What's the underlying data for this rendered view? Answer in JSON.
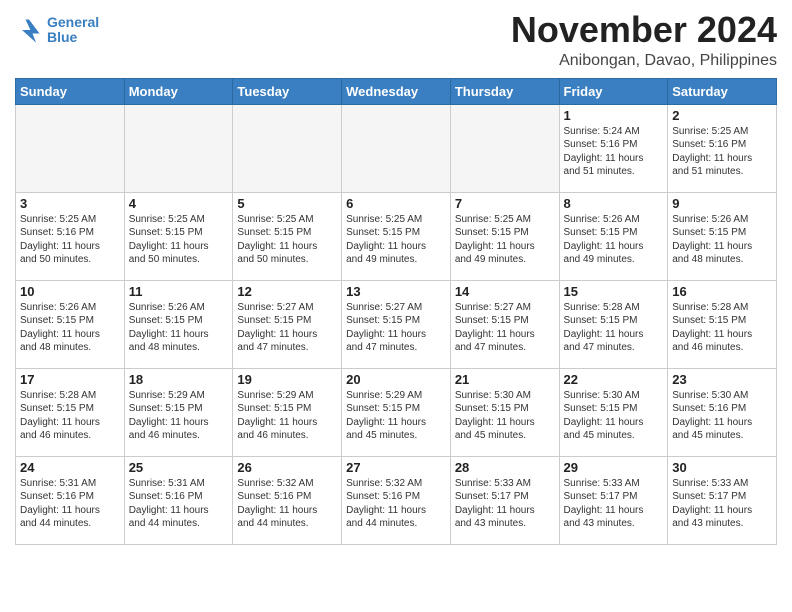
{
  "header": {
    "logo_line1": "General",
    "logo_line2": "Blue",
    "month": "November 2024",
    "location": "Anibongan, Davao, Philippines"
  },
  "days_of_week": [
    "Sunday",
    "Monday",
    "Tuesday",
    "Wednesday",
    "Thursday",
    "Friday",
    "Saturday"
  ],
  "weeks": [
    [
      {
        "day": "",
        "info": ""
      },
      {
        "day": "",
        "info": ""
      },
      {
        "day": "",
        "info": ""
      },
      {
        "day": "",
        "info": ""
      },
      {
        "day": "",
        "info": ""
      },
      {
        "day": "1",
        "info": "Sunrise: 5:24 AM\nSunset: 5:16 PM\nDaylight: 11 hours\nand 51 minutes."
      },
      {
        "day": "2",
        "info": "Sunrise: 5:25 AM\nSunset: 5:16 PM\nDaylight: 11 hours\nand 51 minutes."
      }
    ],
    [
      {
        "day": "3",
        "info": "Sunrise: 5:25 AM\nSunset: 5:16 PM\nDaylight: 11 hours\nand 50 minutes."
      },
      {
        "day": "4",
        "info": "Sunrise: 5:25 AM\nSunset: 5:15 PM\nDaylight: 11 hours\nand 50 minutes."
      },
      {
        "day": "5",
        "info": "Sunrise: 5:25 AM\nSunset: 5:15 PM\nDaylight: 11 hours\nand 50 minutes."
      },
      {
        "day": "6",
        "info": "Sunrise: 5:25 AM\nSunset: 5:15 PM\nDaylight: 11 hours\nand 49 minutes."
      },
      {
        "day": "7",
        "info": "Sunrise: 5:25 AM\nSunset: 5:15 PM\nDaylight: 11 hours\nand 49 minutes."
      },
      {
        "day": "8",
        "info": "Sunrise: 5:26 AM\nSunset: 5:15 PM\nDaylight: 11 hours\nand 49 minutes."
      },
      {
        "day": "9",
        "info": "Sunrise: 5:26 AM\nSunset: 5:15 PM\nDaylight: 11 hours\nand 48 minutes."
      }
    ],
    [
      {
        "day": "10",
        "info": "Sunrise: 5:26 AM\nSunset: 5:15 PM\nDaylight: 11 hours\nand 48 minutes."
      },
      {
        "day": "11",
        "info": "Sunrise: 5:26 AM\nSunset: 5:15 PM\nDaylight: 11 hours\nand 48 minutes."
      },
      {
        "day": "12",
        "info": "Sunrise: 5:27 AM\nSunset: 5:15 PM\nDaylight: 11 hours\nand 47 minutes."
      },
      {
        "day": "13",
        "info": "Sunrise: 5:27 AM\nSunset: 5:15 PM\nDaylight: 11 hours\nand 47 minutes."
      },
      {
        "day": "14",
        "info": "Sunrise: 5:27 AM\nSunset: 5:15 PM\nDaylight: 11 hours\nand 47 minutes."
      },
      {
        "day": "15",
        "info": "Sunrise: 5:28 AM\nSunset: 5:15 PM\nDaylight: 11 hours\nand 47 minutes."
      },
      {
        "day": "16",
        "info": "Sunrise: 5:28 AM\nSunset: 5:15 PM\nDaylight: 11 hours\nand 46 minutes."
      }
    ],
    [
      {
        "day": "17",
        "info": "Sunrise: 5:28 AM\nSunset: 5:15 PM\nDaylight: 11 hours\nand 46 minutes."
      },
      {
        "day": "18",
        "info": "Sunrise: 5:29 AM\nSunset: 5:15 PM\nDaylight: 11 hours\nand 46 minutes."
      },
      {
        "day": "19",
        "info": "Sunrise: 5:29 AM\nSunset: 5:15 PM\nDaylight: 11 hours\nand 46 minutes."
      },
      {
        "day": "20",
        "info": "Sunrise: 5:29 AM\nSunset: 5:15 PM\nDaylight: 11 hours\nand 45 minutes."
      },
      {
        "day": "21",
        "info": "Sunrise: 5:30 AM\nSunset: 5:15 PM\nDaylight: 11 hours\nand 45 minutes."
      },
      {
        "day": "22",
        "info": "Sunrise: 5:30 AM\nSunset: 5:15 PM\nDaylight: 11 hours\nand 45 minutes."
      },
      {
        "day": "23",
        "info": "Sunrise: 5:30 AM\nSunset: 5:16 PM\nDaylight: 11 hours\nand 45 minutes."
      }
    ],
    [
      {
        "day": "24",
        "info": "Sunrise: 5:31 AM\nSunset: 5:16 PM\nDaylight: 11 hours\nand 44 minutes."
      },
      {
        "day": "25",
        "info": "Sunrise: 5:31 AM\nSunset: 5:16 PM\nDaylight: 11 hours\nand 44 minutes."
      },
      {
        "day": "26",
        "info": "Sunrise: 5:32 AM\nSunset: 5:16 PM\nDaylight: 11 hours\nand 44 minutes."
      },
      {
        "day": "27",
        "info": "Sunrise: 5:32 AM\nSunset: 5:16 PM\nDaylight: 11 hours\nand 44 minutes."
      },
      {
        "day": "28",
        "info": "Sunrise: 5:33 AM\nSunset: 5:17 PM\nDaylight: 11 hours\nand 43 minutes."
      },
      {
        "day": "29",
        "info": "Sunrise: 5:33 AM\nSunset: 5:17 PM\nDaylight: 11 hours\nand 43 minutes."
      },
      {
        "day": "30",
        "info": "Sunrise: 5:33 AM\nSunset: 5:17 PM\nDaylight: 11 hours\nand 43 minutes."
      }
    ]
  ]
}
